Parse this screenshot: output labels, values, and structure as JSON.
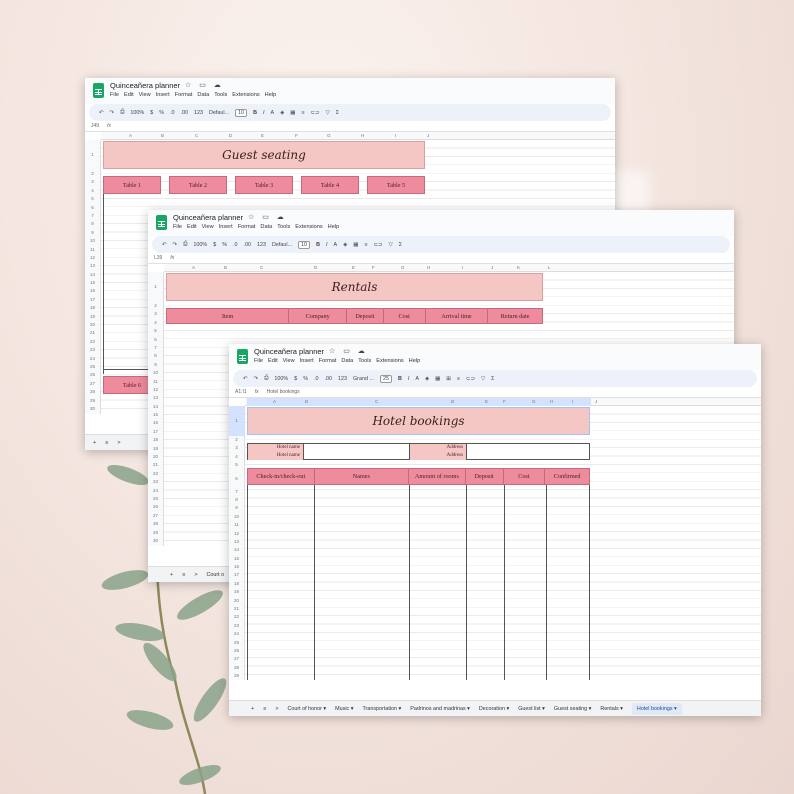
{
  "app": {
    "title": "Quinceañera planner",
    "menu": [
      "File",
      "Edit",
      "View",
      "Insert",
      "Format",
      "Data",
      "Tools",
      "Extensions",
      "Help"
    ],
    "toolbar": {
      "zoom": "100%",
      "currency": "$",
      "percent": "%",
      "decimal_dec": ".0",
      "decimal_inc": ".00",
      "format_123": "123",
      "font_default": "Defaul...",
      "font_grand": "Grand ...",
      "size_10": "10",
      "size_25": "25"
    }
  },
  "window1": {
    "cell_ref": "J49",
    "fx": "fx",
    "sheet_title": "Guest seating",
    "columns": [
      "A",
      "B",
      "C",
      "D",
      "E",
      "F",
      "G",
      "H",
      "I",
      "J"
    ],
    "tables": [
      "Table 1",
      "Table 2",
      "Table 3",
      "Table 4",
      "Table 5"
    ],
    "table6": "Table 6"
  },
  "window2": {
    "cell_ref": "L39",
    "fx": "fx",
    "sheet_title": "Rentals",
    "columns": [
      "A",
      "B",
      "C",
      "D",
      "E",
      "F",
      "G",
      "H",
      "I",
      "J",
      "K",
      "L"
    ],
    "headers": [
      "Item",
      "Company",
      "Deposit",
      "Cost",
      "Arrival time",
      "Return date"
    ],
    "tab_partial": "Court o"
  },
  "window3": {
    "cell_ref": "A1:I1",
    "fx": "fx",
    "formula": "Hotel bookings",
    "sheet_title": "Hotel bookings",
    "columns": [
      "A",
      "B",
      "C",
      "D",
      "E",
      "F",
      "G",
      "H",
      "I",
      "J"
    ],
    "hotel_name_label": "Hotel name",
    "address_label": "Address",
    "headers": [
      "Check-in/check-out",
      "Names",
      "Amount of rooms",
      "Deposit",
      "Cost",
      "Confirmed"
    ],
    "tabs": [
      "Court of honor",
      "Music",
      "Transportation",
      "Padrinos and madrinas",
      "Decoration",
      "Guest list",
      "Guest seating",
      "Rentals",
      "Hotel bookings"
    ],
    "active_tab": "Hotel bookings"
  },
  "row_numbers": [
    "1",
    "2",
    "3",
    "4",
    "5",
    "6",
    "7",
    "8",
    "9",
    "10",
    "11",
    "12",
    "13",
    "14",
    "15",
    "16",
    "17",
    "18",
    "19",
    "20",
    "21",
    "22",
    "23",
    "24",
    "25",
    "26",
    "27",
    "28",
    "29",
    "30",
    "31",
    "32"
  ],
  "colors": {
    "banner": "#f5c7c4",
    "header_row": "#ee8b9c",
    "sheets_green": "#16a765"
  }
}
